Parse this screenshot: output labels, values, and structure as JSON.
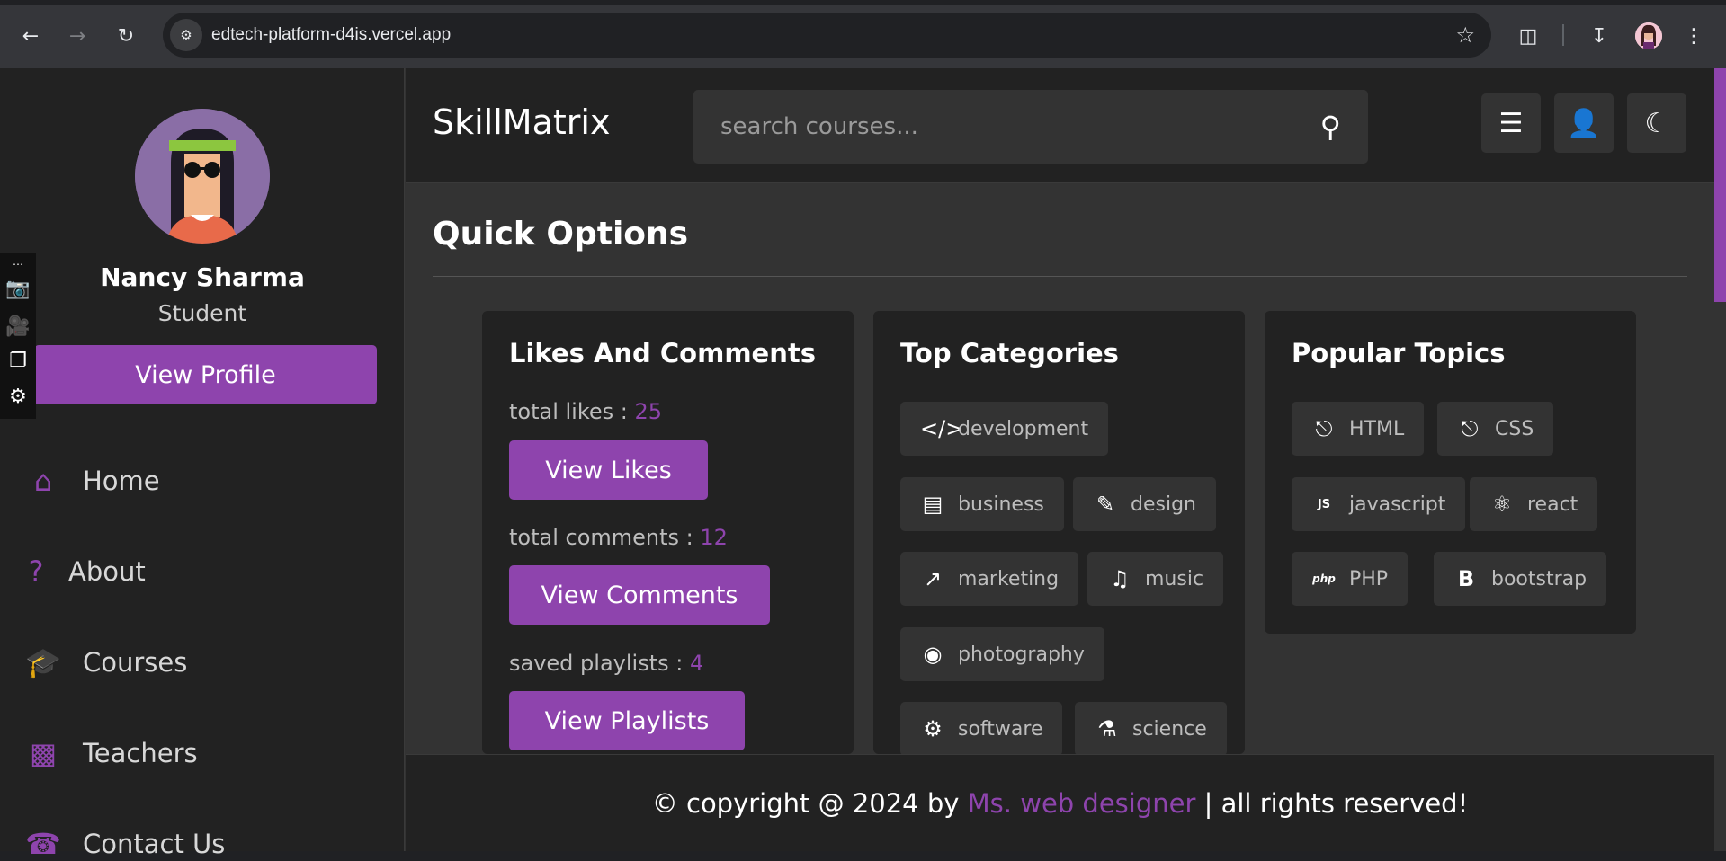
{
  "browser": {
    "url": "edtech-platform-d4is.vercel.app"
  },
  "sidebar": {
    "name": "Nancy Sharma",
    "role": "Student",
    "view_profile": "View Profile",
    "items": [
      {
        "label": "Home",
        "icon": "home-icon"
      },
      {
        "label": "About",
        "icon": "question-icon"
      },
      {
        "label": "Courses",
        "icon": "graduation-cap-icon"
      },
      {
        "label": "Teachers",
        "icon": "chalkboard-teacher-icon"
      },
      {
        "label": "Contact Us",
        "icon": "headset-icon"
      }
    ]
  },
  "header": {
    "logo": "SkillMatrix",
    "search_placeholder": "search courses..."
  },
  "main": {
    "heading": "Quick Options",
    "likes_card": {
      "title": "Likes And Comments",
      "likes_label": "total likes : ",
      "likes_value": "25",
      "likes_button": "View Likes",
      "comments_label": "total comments : ",
      "comments_value": "12",
      "comments_button": "View Comments",
      "playlists_label": "saved playlists : ",
      "playlists_value": "4",
      "playlists_button": "View Playlists"
    },
    "categories_card": {
      "title": "Top Categories",
      "tags": [
        {
          "label": "development",
          "icon": "code-icon"
        },
        {
          "label": "business",
          "icon": "bar-chart-icon"
        },
        {
          "label": "design",
          "icon": "pen-icon"
        },
        {
          "label": "marketing",
          "icon": "line-chart-icon"
        },
        {
          "label": "music",
          "icon": "music-icon"
        },
        {
          "label": "photography",
          "icon": "camera-icon"
        },
        {
          "label": "software",
          "icon": "gear-icon"
        },
        {
          "label": "science",
          "icon": "vial-icon"
        }
      ]
    },
    "topics_card": {
      "title": "Popular Topics",
      "tags": [
        {
          "label": "HTML",
          "icon": "html5-icon"
        },
        {
          "label": "CSS",
          "icon": "css3-icon"
        },
        {
          "label": "javascript",
          "icon": "js-icon"
        },
        {
          "label": "react",
          "icon": "react-icon"
        },
        {
          "label": "PHP",
          "icon": "php-icon"
        },
        {
          "label": "bootstrap",
          "icon": "bootstrap-icon"
        }
      ]
    }
  },
  "footer": {
    "prefix": "© copyright @ 2024 by ",
    "brand": "Ms. web designer",
    "suffix": " | all rights reserved!"
  },
  "colors": {
    "accent": "#8e44ad",
    "background": "#333333",
    "panel": "#222222"
  }
}
